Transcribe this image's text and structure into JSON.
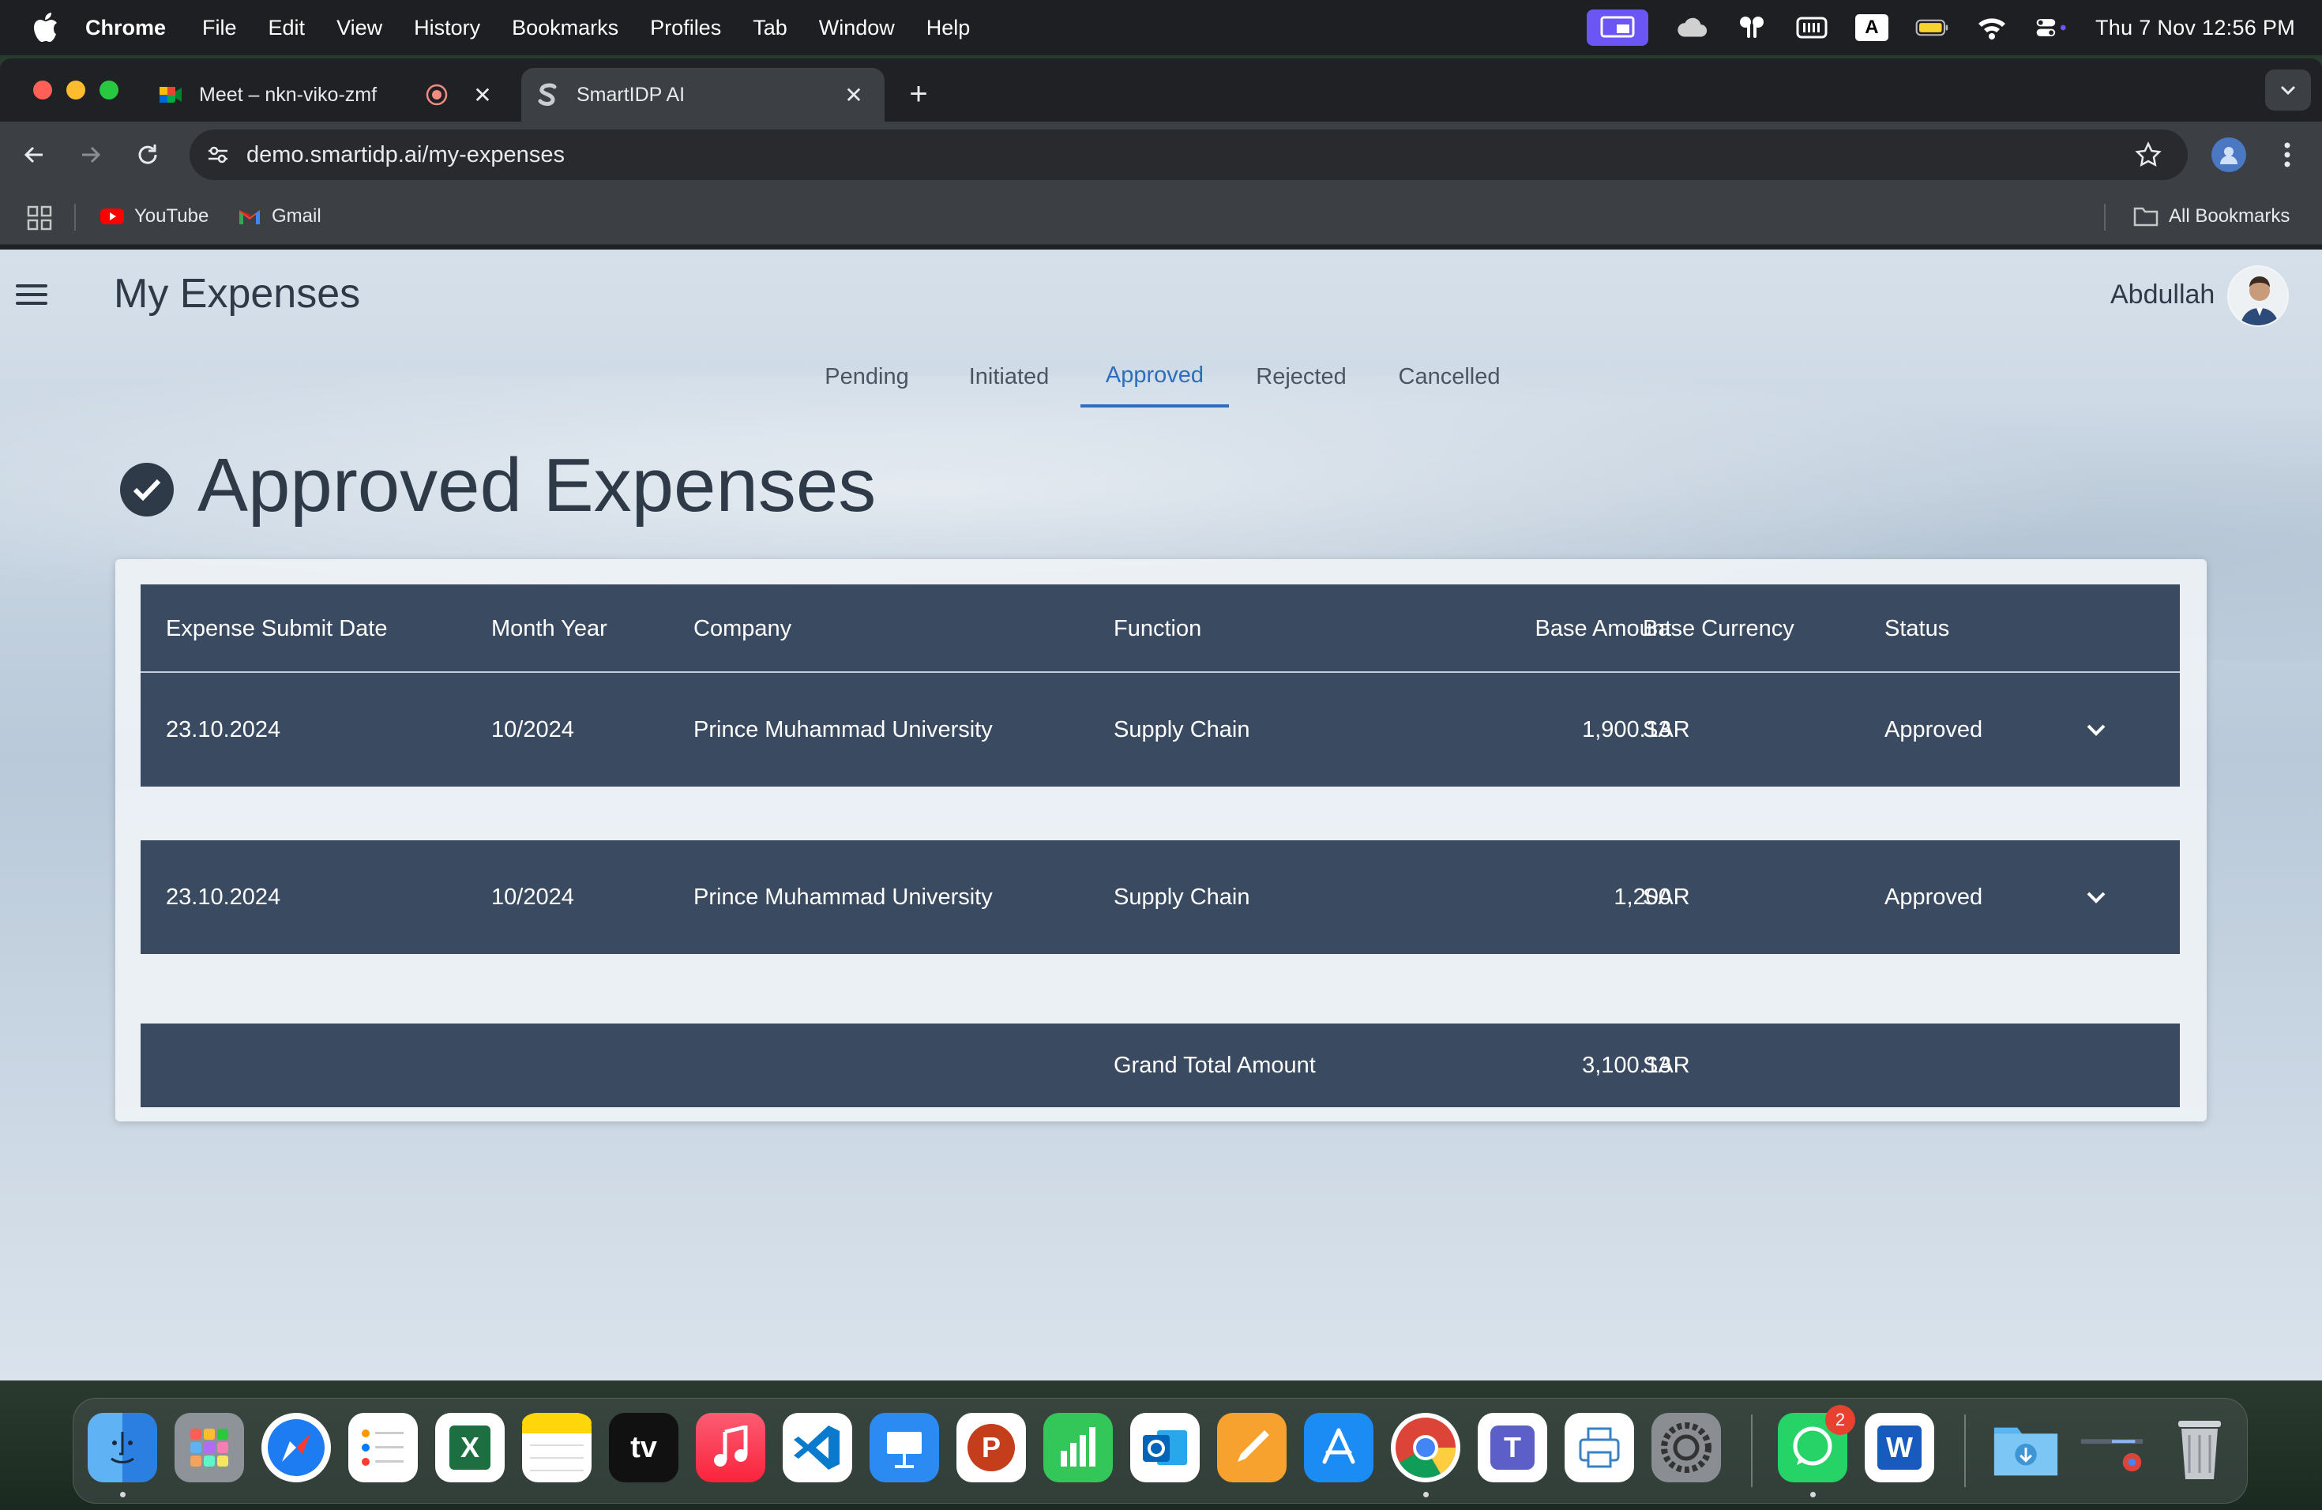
{
  "menubar": {
    "app_name": "Chrome",
    "items": [
      "File",
      "Edit",
      "View",
      "History",
      "Bookmarks",
      "Profiles",
      "Tab",
      "Window",
      "Help"
    ],
    "keyboard_indicator": "A",
    "clock": "Thu 7 Nov  12:56 PM"
  },
  "browser": {
    "tabs": [
      {
        "title": "Meet – nkn-viko-zmf",
        "favicon": "google-meet-icon",
        "recording": true
      },
      {
        "title": "SmartIDP AI",
        "favicon": "smartidp-icon",
        "active": true
      }
    ],
    "url": "demo.smartidp.ai/my-expenses",
    "bookmarks": [
      {
        "label": "YouTube",
        "icon": "youtube-icon"
      },
      {
        "label": "Gmail",
        "icon": "gmail-icon"
      }
    ],
    "all_bookmarks": "All Bookmarks"
  },
  "app": {
    "page_title": "My Expenses",
    "user_name": "Abdullah",
    "tabs": [
      "Pending",
      "Initiated",
      "Approved",
      "Rejected",
      "Cancelled"
    ],
    "active_tab": "Approved",
    "section_title": "Approved Expenses",
    "table": {
      "headers": {
        "submit_date": "Expense Submit Date",
        "month_year": "Month Year",
        "company": "Company",
        "function": "Function",
        "base_amount": "Base Amount",
        "base_currency": "Base Currency",
        "status": "Status"
      },
      "rows": [
        {
          "submit_date": "23.10.2024",
          "month_year": "10/2024",
          "company": "Prince Muhammad University",
          "function": "Supply Chain",
          "base_amount": "1,900.13",
          "base_currency": "SAR",
          "status": "Approved"
        },
        {
          "submit_date": "23.10.2024",
          "month_year": "10/2024",
          "company": "Prince Muhammad University",
          "function": "Supply Chain",
          "base_amount": "1,200",
          "base_currency": "SAR",
          "status": "Approved"
        }
      ],
      "total": {
        "label": "Grand Total Amount",
        "amount": "3,100.13",
        "currency": "SAR"
      }
    },
    "colors": {
      "primary": "#3a4a60",
      "accent": "#2d6dbf",
      "text": "#2f3a48"
    }
  },
  "dock": {
    "apps": [
      "Finder",
      "Launchpad",
      "Safari",
      "Reminders",
      "Excel",
      "Notes",
      "TV",
      "Music",
      "VS Code",
      "Keynote",
      "PowerPoint",
      "Numbers",
      "Outlook",
      "Pages",
      "App Store",
      "Chrome",
      "Teams",
      "Printer",
      "System Settings",
      "WhatsApp",
      "Word",
      "Downloads",
      "Chrome Window",
      "Trash"
    ],
    "whatsapp_badge": "2",
    "tv_label": "tv",
    "excel_letter": "X",
    "powerpoint_letter": "P",
    "word_letter": "W",
    "teams_letter": "T"
  }
}
